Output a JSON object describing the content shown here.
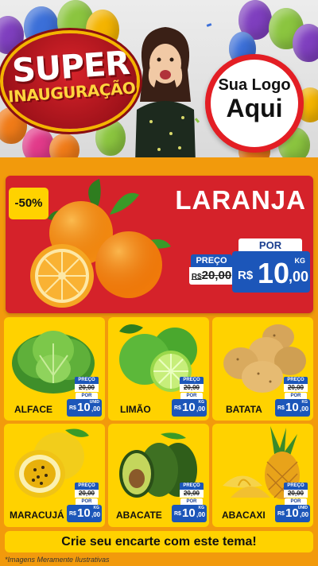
{
  "header": {
    "title_line1": "SUPER",
    "title_line2": "INAUGURAÇÃO",
    "logo_line1": "Sua Logo",
    "logo_line2": "Aqui"
  },
  "hero": {
    "discount": "-50%",
    "product": "LARANJA",
    "old_label": "PREÇO",
    "old_price_currency": "R$",
    "old_price": "20,00",
    "new_label": "POR",
    "currency": "R$",
    "price_int": "10",
    "price_dec": ",00",
    "unit": "KG"
  },
  "products": [
    {
      "name": "ALFACE",
      "old_label": "PREÇO",
      "old_price": "20,00",
      "new_label": "POR",
      "currency": "R$",
      "price_int": "10",
      "price_dec": ",00",
      "unit": "UNID"
    },
    {
      "name": "LIMÃO",
      "old_label": "PREÇO",
      "old_price": "20,00",
      "new_label": "POR",
      "currency": "R$",
      "price_int": "10",
      "price_dec": ",00",
      "unit": "KG"
    },
    {
      "name": "BATATA",
      "old_label": "PREÇO",
      "old_price": "20,00",
      "new_label": "POR",
      "currency": "R$",
      "price_int": "10",
      "price_dec": ",00",
      "unit": "KG"
    },
    {
      "name": "MARACUJÁ",
      "old_label": "PREÇO",
      "old_price": "20,00",
      "new_label": "POR",
      "currency": "R$",
      "price_int": "10",
      "price_dec": ",00",
      "unit": "KG"
    },
    {
      "name": "ABACATE",
      "old_label": "PREÇO",
      "old_price": "20,00",
      "new_label": "POR",
      "currency": "R$",
      "price_int": "10",
      "price_dec": ",00",
      "unit": "KG"
    },
    {
      "name": "ABACAXI",
      "old_label": "PREÇO",
      "old_price": "20,00",
      "new_label": "POR",
      "currency": "R$",
      "price_int": "10",
      "price_dec": ",00",
      "unit": "UNID"
    }
  ],
  "footer": {
    "cta": "Crie seu encarte com este tema!",
    "disclaimer": "*Imagens Meramente Ilustrativas"
  },
  "colors": {
    "background_orange": "#f29a0c",
    "hero_red": "#d5222a",
    "card_yellow": "#ffd200",
    "price_blue": "#1c56b9",
    "logo_ring_red": "#e31e24"
  },
  "icons": {
    "hero": "orange-fruit-illustration",
    "alface": "lettuce-illustration",
    "limao": "lime-illustration",
    "batata": "potato-illustration",
    "maracuja": "passion-fruit-illustration",
    "abacate": "avocado-illustration",
    "abacaxi": "pineapple-illustration"
  }
}
